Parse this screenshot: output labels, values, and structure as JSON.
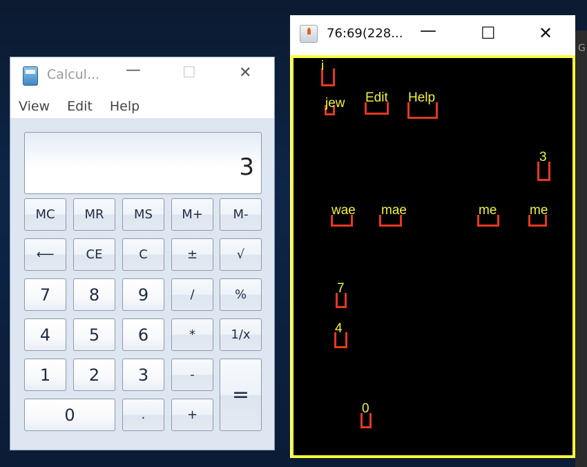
{
  "background_strip": {
    "partial_text": "G"
  },
  "calculator": {
    "title": "Calcul...",
    "menu": [
      "View",
      "Edit",
      "Help"
    ],
    "display": "3",
    "buttons": [
      "MC",
      "MR",
      "MS",
      "M+",
      "M-",
      "⟵",
      "CE",
      "C",
      "±",
      "√",
      "7",
      "8",
      "9",
      "/",
      "%",
      "4",
      "5",
      "6",
      "*",
      "1/x",
      "1",
      "2",
      "3",
      "-",
      "=",
      "0",
      ".",
      "+"
    ]
  },
  "java_window": {
    "title": "76:69(228...",
    "overlay_color": "#f2f23a",
    "box_color": "#e43a1d",
    "labels": [
      "i",
      "jew",
      "Edit",
      "Help",
      "3",
      "wae",
      "mae",
      "me",
      "me",
      "7",
      "4",
      "0"
    ]
  }
}
